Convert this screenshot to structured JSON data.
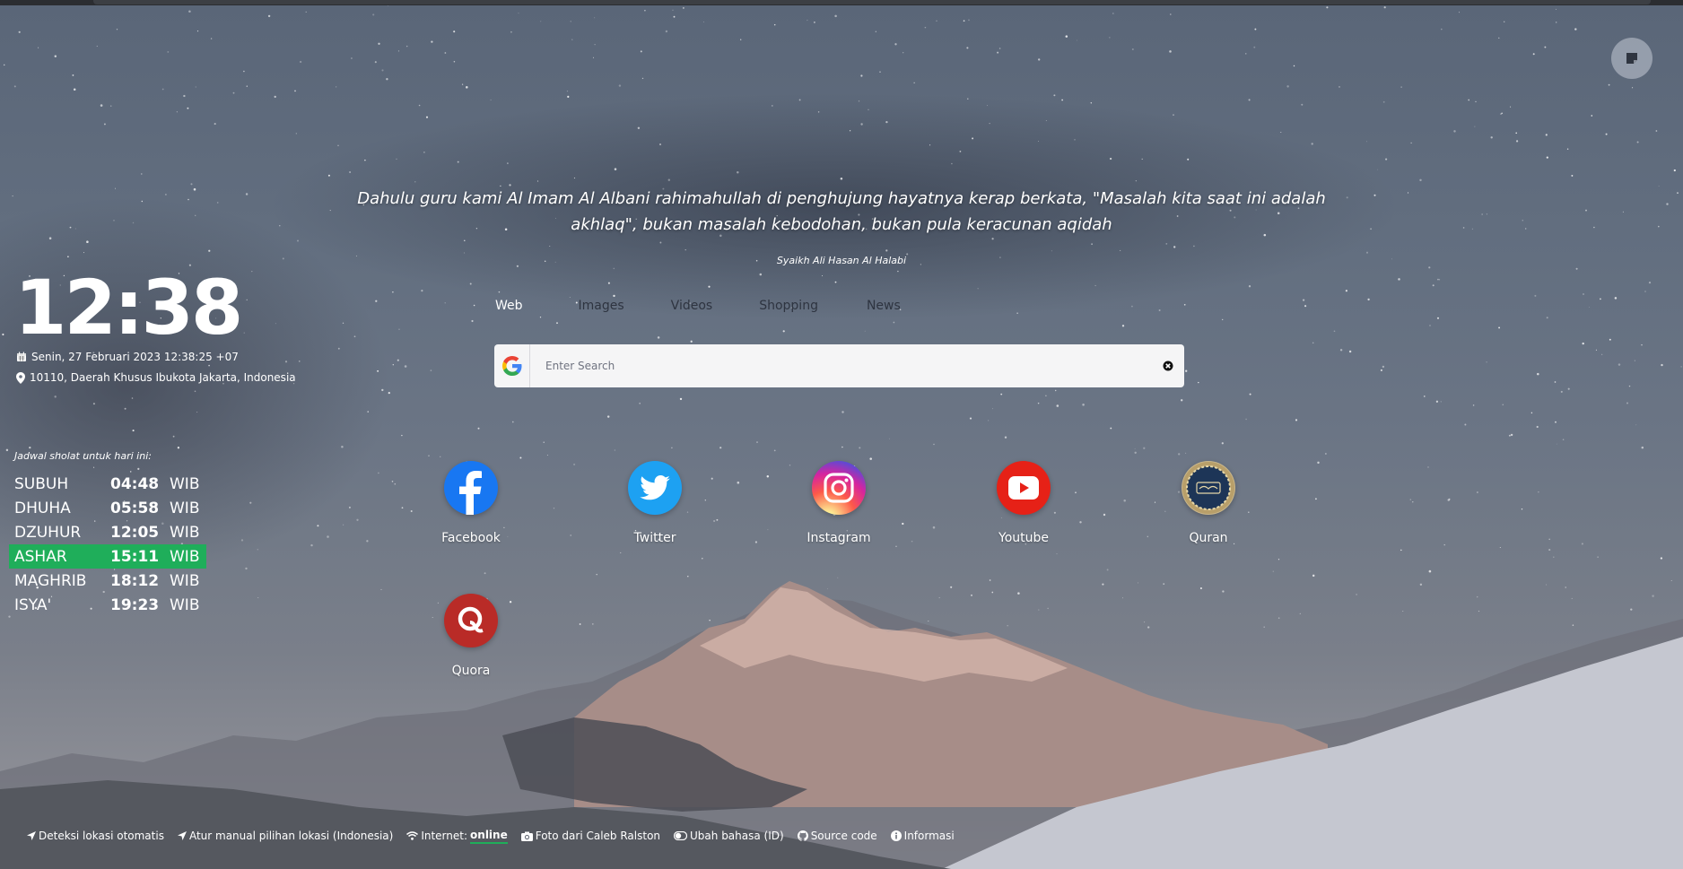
{
  "quote": {
    "text": "Dahulu guru kami Al Imam Al Albani rahimahullah di penghujung hayatnya kerap berkata, \"Masalah kita saat ini adalah akhlaq\", bukan masalah kebodohan, bukan pula keracunan aqidah",
    "author": "Syaikh Ali Hasan Al Halabi"
  },
  "search": {
    "tabs": [
      {
        "label": "Web",
        "active": true
      },
      {
        "label": "Images"
      },
      {
        "label": "Videos"
      },
      {
        "label": "Shopping"
      },
      {
        "label": "News"
      }
    ],
    "placeholder": "Enter Search",
    "engine_icon": "google-icon"
  },
  "shortcuts": [
    {
      "label": "Facebook",
      "icon": "facebook-icon",
      "color": "#1877f2"
    },
    {
      "label": "Twitter",
      "icon": "twitter-icon",
      "color": "#1da1f2"
    },
    {
      "label": "Instagram",
      "icon": "instagram-icon",
      "color": "#d6249f"
    },
    {
      "label": "Youtube",
      "icon": "youtube-icon",
      "color": "#e62117"
    },
    {
      "label": "Quran",
      "icon": "quran-icon",
      "color": "#1d3557"
    },
    {
      "label": "Quora",
      "icon": "quora-icon",
      "color": "#b92b27"
    }
  ],
  "clock": {
    "time": "12:38",
    "date": "Senin, 27 Februari 2023 12:38:25 +07",
    "location": "10110, Daerah Khusus Ibukota Jakarta, Indonesia"
  },
  "prayer": {
    "title": "Jadwal sholat untuk hari ini:",
    "highlight_color": "#1fae5a",
    "rows": [
      {
        "name": "SUBUH",
        "time": "04:48",
        "zone": "WIB"
      },
      {
        "name": "DHUHA",
        "time": "05:58",
        "zone": "WIB"
      },
      {
        "name": "DZUHUR",
        "time": "12:05",
        "zone": "WIB"
      },
      {
        "name": "ASHAR",
        "time": "15:11",
        "zone": "WIB",
        "current": true
      },
      {
        "name": "MAGHRIB",
        "time": "18:12",
        "zone": "WIB"
      },
      {
        "name": "ISYA'",
        "time": "19:23",
        "zone": "WIB"
      }
    ]
  },
  "footer": {
    "auto_location": "Deteksi lokasi otomatis",
    "manual_location": "Atur manual pilihan lokasi (Indonesia)",
    "internet_label": "Internet:",
    "internet_status": "online",
    "photo_credit": "Foto dari Caleb Ralston",
    "language": "Ubah bahasa (ID)",
    "source": "Source code",
    "info": "Informasi"
  }
}
